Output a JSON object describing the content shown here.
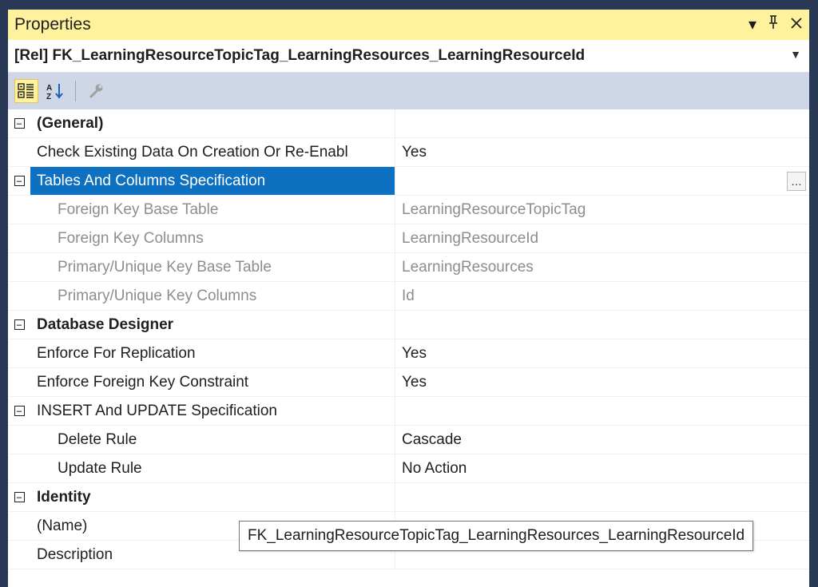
{
  "window": {
    "title": "Properties",
    "icons": {
      "dropdown": "▾",
      "pin": "pin-icon",
      "close": "close-icon"
    }
  },
  "object_selector": {
    "value": "[Rel] FK_LearningResourceTopicTag_LearningResources_LearningResourceId"
  },
  "toolbar": {
    "buttons": [
      "categorized-icon",
      "alphabetical-icon",
      "property-pages-icon"
    ]
  },
  "grid": {
    "rows": [
      {
        "name": "(General)",
        "value": "",
        "type": "cat"
      },
      {
        "name": "Check Existing Data On Creation Or Re-Enabl",
        "value": "Yes",
        "type": "prop"
      },
      {
        "name": "Tables And Columns Specification",
        "value": "",
        "type": "group-selected"
      },
      {
        "name": "Foreign Key Base Table",
        "value": "LearningResourceTopicTag",
        "type": "sub-dim"
      },
      {
        "name": "Foreign Key Columns",
        "value": "LearningResourceId",
        "type": "sub-dim"
      },
      {
        "name": "Primary/Unique Key Base Table",
        "value": "LearningResources",
        "type": "sub-dim"
      },
      {
        "name": "Primary/Unique Key Columns",
        "value": "Id",
        "type": "sub-dim"
      },
      {
        "name": "Database Designer",
        "value": "",
        "type": "cat"
      },
      {
        "name": "Enforce For Replication",
        "value": "Yes",
        "type": "prop"
      },
      {
        "name": "Enforce Foreign Key Constraint",
        "value": "Yes",
        "type": "prop"
      },
      {
        "name": "INSERT And UPDATE Specification",
        "value": "",
        "type": "group"
      },
      {
        "name": "Delete Rule",
        "value": "Cascade",
        "type": "sub"
      },
      {
        "name": "Update Rule",
        "value": "No Action",
        "type": "sub"
      },
      {
        "name": "Identity",
        "value": "",
        "type": "cat"
      },
      {
        "name": "(Name)",
        "value": "",
        "type": "prop"
      },
      {
        "name": "Description",
        "value": "",
        "type": "prop"
      }
    ]
  },
  "tooltip": {
    "text": "FK_LearningResourceTopicTag_LearningResources_LearningResourceId"
  },
  "colors": {
    "titlebar": "#fff29d",
    "toolbar": "#cfd6e5",
    "selection": "#0e70c0",
    "frame": "#293955"
  }
}
